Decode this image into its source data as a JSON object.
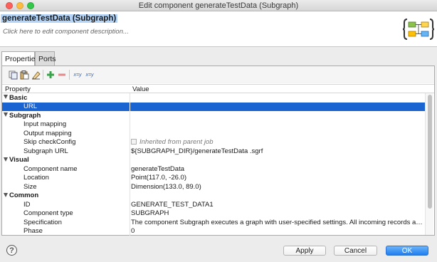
{
  "window": {
    "title": "Edit component generateTestData  (Subgraph)"
  },
  "component": {
    "title": "generateTestData (Subgraph)",
    "description_placeholder": "Click here to edit component description..."
  },
  "tabs": [
    {
      "label": "Properties",
      "active": true
    },
    {
      "label": "Ports",
      "active": false
    }
  ],
  "grid": {
    "headers": {
      "property": "Property",
      "value": "Value"
    },
    "sections": [
      {
        "name": "Basic",
        "rows": [
          {
            "property": "URL",
            "value": "",
            "selected": true
          }
        ]
      },
      {
        "name": "Subgraph",
        "rows": [
          {
            "property": "Input mapping",
            "value": ""
          },
          {
            "property": "Output mapping",
            "value": ""
          },
          {
            "property": "Skip checkConfig",
            "value": "Inherited from parent job",
            "checkbox": true
          },
          {
            "property": "Subgraph URL",
            "value": "${SUBGRAPH_DIR}/generateTestData .sgrf"
          }
        ]
      },
      {
        "name": "Visual",
        "rows": [
          {
            "property": "Component name",
            "value": "generateTestData"
          },
          {
            "property": "Location",
            "value": "Point(117.0, -26.0)"
          },
          {
            "property": "Size",
            "value": "Dimension(133.0, 89.0)"
          }
        ]
      },
      {
        "name": "Common",
        "rows": [
          {
            "property": "ID",
            "value": "GENERATE_TEST_DATA1"
          },
          {
            "property": "Component type",
            "value": "SUBGRAPH"
          },
          {
            "property": "Specification",
            "value": "The component Subgraph executes a graph with user-specified settings. All incoming records are pas..."
          },
          {
            "property": "Phase",
            "value": "0"
          }
        ]
      }
    ]
  },
  "toolbar": {
    "icons": [
      "copy-icon",
      "paste-icon",
      "clear-icon",
      "add-icon",
      "remove-icon",
      "xyz-icon",
      "xyz-param-icon"
    ],
    "label_xyz": "x=y",
    "label_xyz2": "x=y"
  },
  "buttons": {
    "apply": "Apply",
    "cancel": "Cancel",
    "ok": "OK",
    "help": "?"
  },
  "colors": {
    "selection": "#1a64d2",
    "ok_button": "#1d7ef0",
    "title_highlight": "#b3d3f7"
  }
}
